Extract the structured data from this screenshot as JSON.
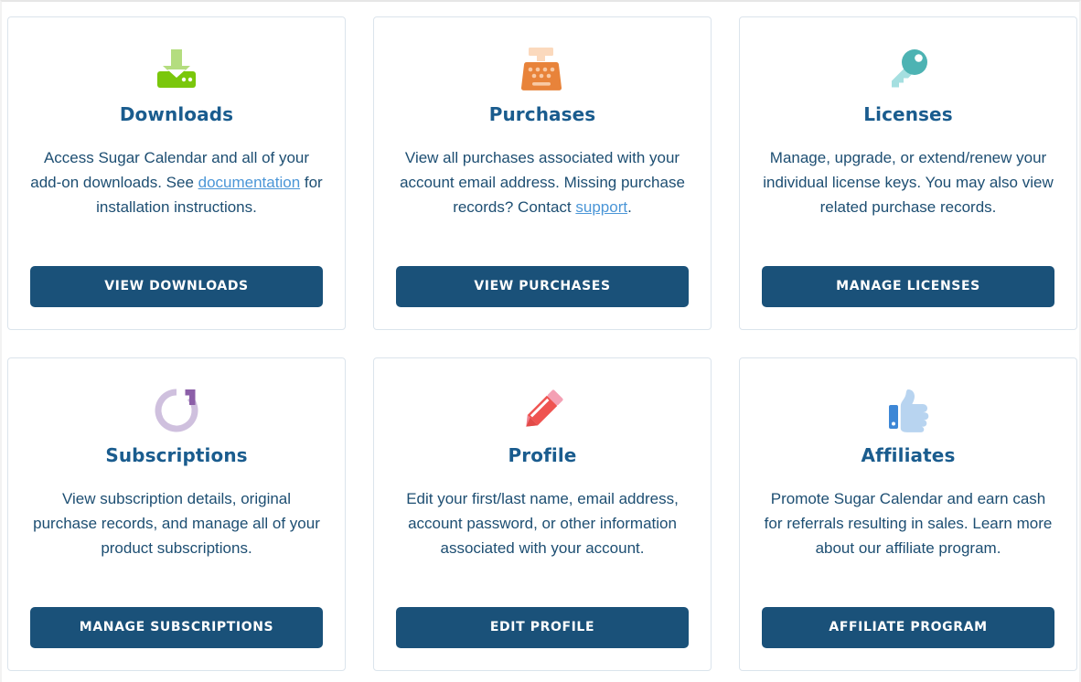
{
  "theme": {
    "card_border": "#dbe4ec",
    "title_color": "#1a5c8e",
    "text_color": "#1d4e72",
    "link_color": "#4b96d7",
    "button_bg": "#1a5179",
    "button_text": "#ffffff",
    "page_bg": "#ffffff"
  },
  "cards": [
    {
      "id": "downloads",
      "icon": "download-icon",
      "icon_colors": {
        "arrow": "#b4dd7f",
        "tray": "#7ac70c"
      },
      "title": "Downloads",
      "desc_before": "Access Sugar Calendar and all of your add-on downloads. See ",
      "link_text": "documentation",
      "desc_after": " for installation instructions.",
      "button_label": "VIEW DOWNLOADS"
    },
    {
      "id": "purchases",
      "icon": "cash-register-icon",
      "icon_colors": {
        "screen": "#fbd9bd",
        "body": "#e8833a"
      },
      "title": "Purchases",
      "desc_before": "View all purchases associated with your account email address. Missing purchase records? Contact ",
      "link_text": "support",
      "desc_after": ".",
      "button_label": "VIEW PURCHASES"
    },
    {
      "id": "licenses",
      "icon": "key-icon",
      "icon_colors": {
        "head": "#4db3b3",
        "shaft": "#a5dfe0"
      },
      "title": "Licenses",
      "desc_before": "Manage, upgrade, or extend/renew your individual license keys. You may also view related purchase records.",
      "link_text": "",
      "desc_after": "",
      "button_label": "MANAGE LICENSES"
    },
    {
      "id": "subscriptions",
      "icon": "renew-arrow-icon",
      "icon_colors": {
        "arc": "#cfc0de",
        "arrow": "#8c5fa8"
      },
      "title": "Subscriptions",
      "desc_before": "View subscription details, original purchase records, and manage all of your product subscriptions.",
      "link_text": "",
      "desc_after": "",
      "button_label": "MANAGE SUBSCRIPTIONS"
    },
    {
      "id": "profile",
      "icon": "pencil-icon",
      "icon_colors": {
        "body": "#ef5350",
        "eraser": "#f4a0b4",
        "tip": "#f07f8e"
      },
      "title": "Profile",
      "desc_before": "Edit your first/last name, email address, account password, or other information associated with your account.",
      "link_text": "",
      "desc_after": "",
      "button_label": "EDIT PROFILE"
    },
    {
      "id": "affiliates",
      "icon": "thumbs-up-icon",
      "icon_colors": {
        "hand": "#b8d4f0",
        "cuff": "#3d87d6"
      },
      "title": "Affiliates",
      "desc_before": "Promote Sugar Calendar and earn cash for referrals resulting in sales. Learn more about our affiliate program.",
      "link_text": "",
      "desc_after": "",
      "button_label": "AFFILIATE PROGRAM"
    }
  ]
}
